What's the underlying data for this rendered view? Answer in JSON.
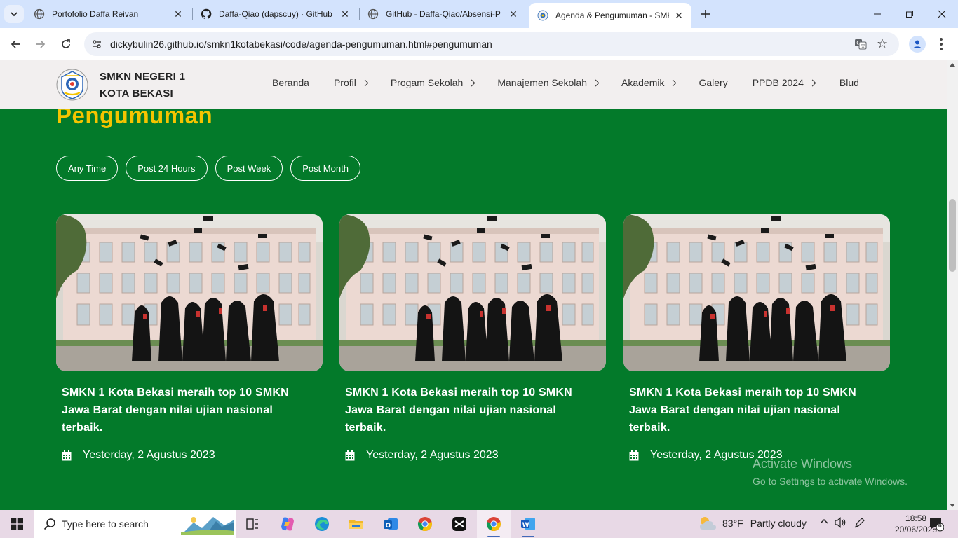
{
  "browser": {
    "tabs": [
      {
        "title": "Portofolio Daffa Reivan",
        "favicon": "globe-icon"
      },
      {
        "title": "Daffa-Qiao (dapscuy) · GitHub",
        "favicon": "github-icon"
      },
      {
        "title": "GitHub - Daffa-Qiao/Absensi-P",
        "favicon": "globe-icon"
      },
      {
        "title": "Agenda & Pengumuman - SMK",
        "favicon": "school-logo-icon",
        "active": true
      }
    ],
    "url": "dickybulin26.github.io/smkn1kotabekasi/code/agenda-pengumuman.html#pengumuman"
  },
  "site": {
    "school_name_line1": "SMKN NEGERI 1",
    "school_name_line2": "KOTA BEKASI",
    "nav": [
      {
        "label": "Beranda",
        "dropdown": false
      },
      {
        "label": "Profil",
        "dropdown": true
      },
      {
        "label": "Progam Sekolah",
        "dropdown": true
      },
      {
        "label": "Manajemen Sekolah",
        "dropdown": true
      },
      {
        "label": "Akademik",
        "dropdown": true
      },
      {
        "label": "Galery",
        "dropdown": false
      },
      {
        "label": "PPDB 2024",
        "dropdown": true
      },
      {
        "label": "Blud",
        "dropdown": false
      }
    ]
  },
  "section": {
    "title": "Pengumuman",
    "filters": [
      "Any Time",
      "Post 24 Hours",
      "Post Week",
      "Post Month"
    ],
    "cards": [
      {
        "headline": "SMKN 1 Kota Bekasi meraih top 10 SMKN Jawa Barat dengan nilai ujian nasional terbaik.",
        "date": "Yesterday, 2 Agustus 2023"
      },
      {
        "headline": "SMKN 1 Kota Bekasi meraih top 10 SMKN Jawa Barat dengan nilai ujian nasional terbaik.",
        "date": "Yesterday, 2 Agustus 2023"
      },
      {
        "headline": "SMKN 1 Kota Bekasi meraih top 10 SMKN Jawa Barat dengan nilai ujian nasional terbaik.",
        "date": "Yesterday, 2 Agustus 2023"
      }
    ]
  },
  "watermark": {
    "line1": "Activate Windows",
    "line2": "Go to Settings to activate Windows."
  },
  "taskbar": {
    "search_placeholder": "Type here to search",
    "weather_temp": "83°F",
    "weather_desc": "Partly cloudy",
    "time": "18:58",
    "date": "20/06/2025",
    "notification_count": "4"
  },
  "colors": {
    "page_green": "#037a2a",
    "title_yellow": "#f5c400",
    "header_bg": "#f2efef",
    "tabstrip_bg": "#d3e3fd"
  }
}
